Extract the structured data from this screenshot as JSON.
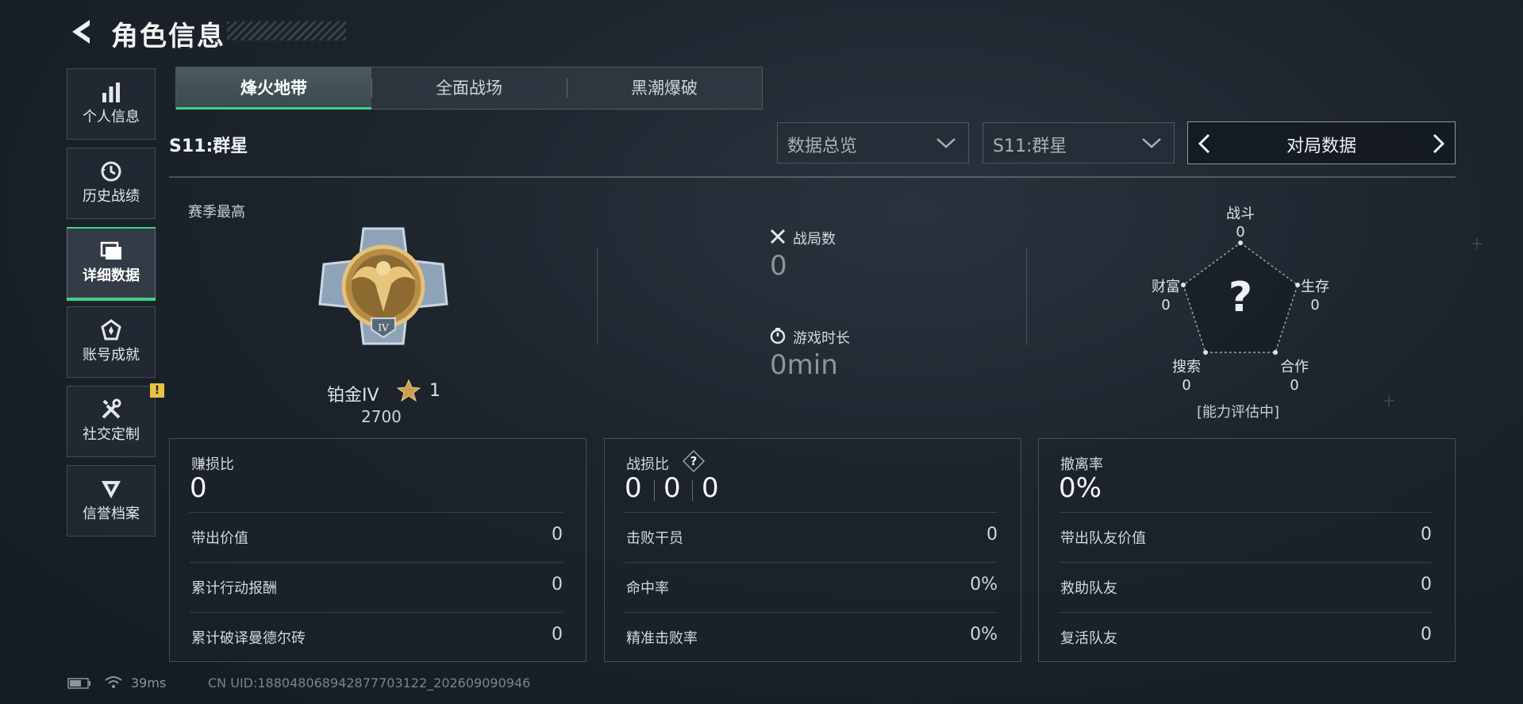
{
  "header": {
    "title": "角色信息"
  },
  "sidebar": {
    "items": [
      {
        "label": "个人信息",
        "icon": "bar-chart-icon"
      },
      {
        "label": "历史战绩",
        "icon": "history-clock-icon"
      },
      {
        "label": "详细数据",
        "icon": "folder-icon",
        "active": true
      },
      {
        "label": "账号成就",
        "icon": "achievement-badge-icon"
      },
      {
        "label": "社交定制",
        "icon": "tools-icon",
        "badge": "!"
      },
      {
        "label": "信誉档案",
        "icon": "shield-emblem-icon"
      }
    ]
  },
  "tabs": [
    {
      "label": "烽火地带",
      "active": true
    },
    {
      "label": "全面战场"
    },
    {
      "label": "黑潮爆破"
    }
  ],
  "filters": {
    "season_label": "S11:群星",
    "dropdown_overview": "数据总览",
    "dropdown_season": "S11:群星",
    "pager_label": "对局数据"
  },
  "summary": {
    "season_best_label": "赛季最高",
    "rank_name": "铂金IV",
    "rank_stars": "1",
    "rank_score": "2700",
    "matches_label": "战局数",
    "matches_value": "0",
    "playtime_label": "游戏时长",
    "playtime_value": "0min"
  },
  "radar": {
    "combat_label": "战斗",
    "combat_value": "0",
    "survival_label": "生存",
    "survival_value": "0",
    "teamwork_label": "合作",
    "teamwork_value": "0",
    "search_label": "搜索",
    "search_value": "0",
    "wealth_label": "财富",
    "wealth_value": "0",
    "center_mark": "?",
    "status": "[能力评估中]"
  },
  "panels": {
    "profit": {
      "title": "赚损比",
      "value": "0",
      "rows": [
        {
          "label": "带出价值",
          "value": "0"
        },
        {
          "label": "累计行动报酬",
          "value": "0"
        },
        {
          "label": "累计破译曼德尔砖",
          "value": "0"
        }
      ]
    },
    "kd": {
      "title": "战损比",
      "help": "?",
      "values": [
        "0",
        "0",
        "0"
      ],
      "rows": [
        {
          "label": "击败干员",
          "value": "0"
        },
        {
          "label": "命中率",
          "value": "0%"
        },
        {
          "label": "精准击败率",
          "value": "0%"
        }
      ]
    },
    "extract": {
      "title": "撤离率",
      "value": "0%",
      "rows": [
        {
          "label": "带出队友价值",
          "value": "0"
        },
        {
          "label": "救助队友",
          "value": "0"
        },
        {
          "label": "复活队友",
          "value": "0"
        }
      ]
    }
  },
  "footer": {
    "ping": "39ms",
    "uid": "CN UID:18804806894287770312​2_202609090946"
  },
  "colors": {
    "accent": "#3ed28b",
    "badge": "#e6c340"
  }
}
